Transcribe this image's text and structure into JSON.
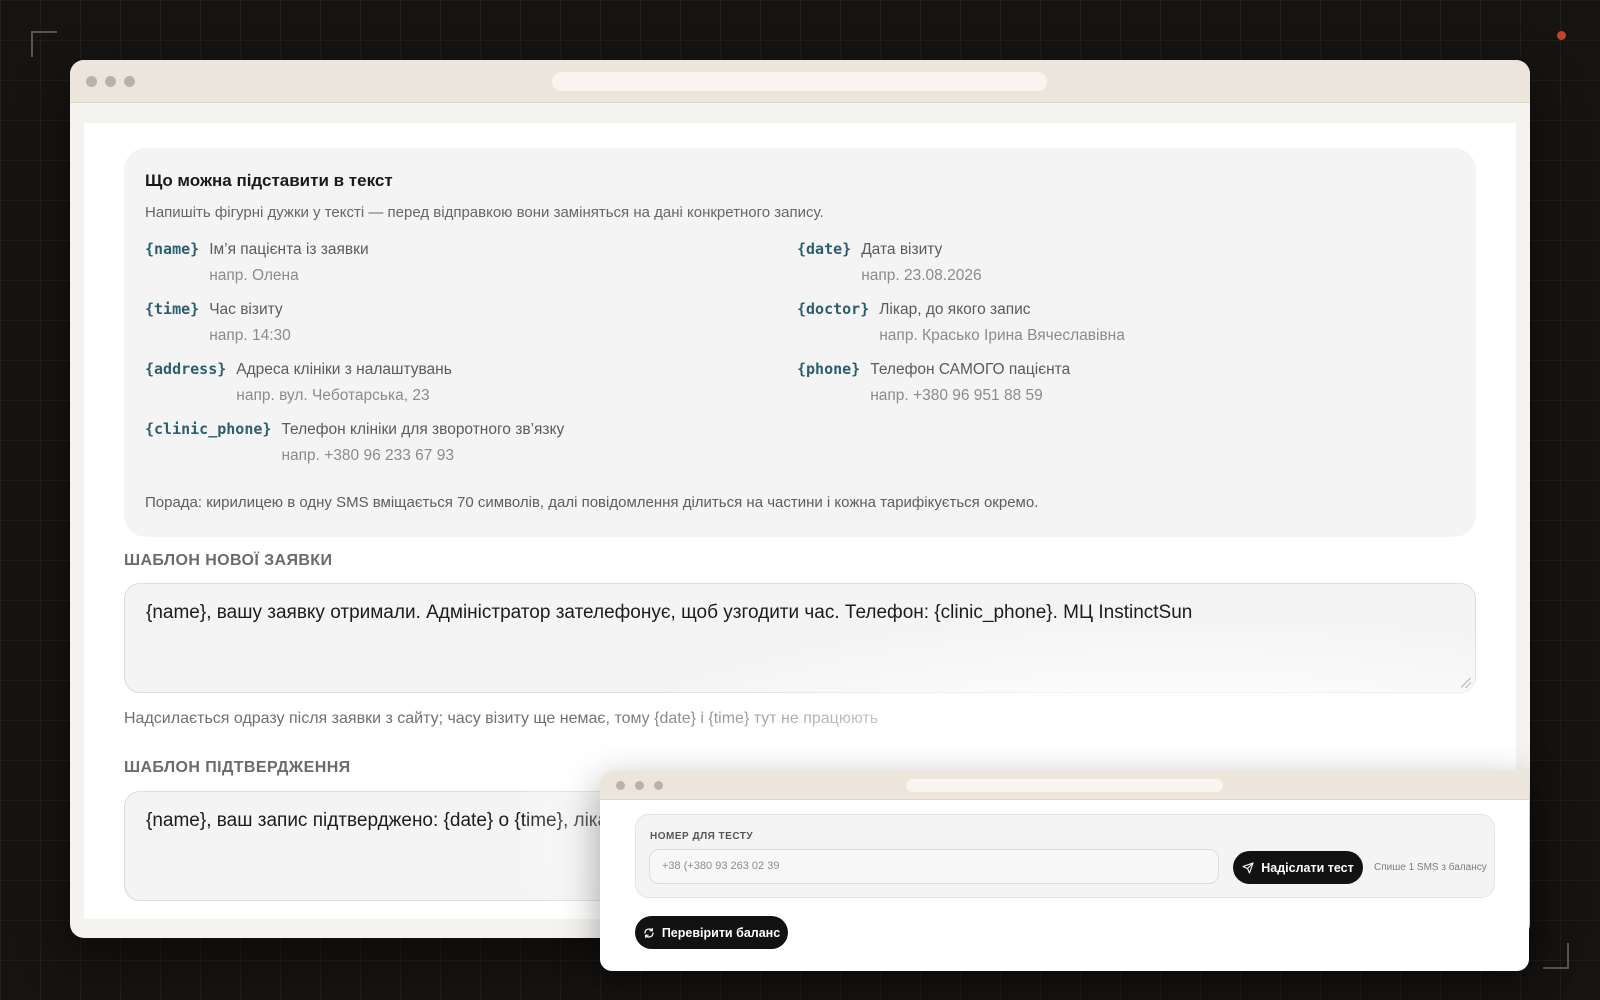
{
  "main": {
    "info_card": {
      "title": "Що можна підставити в текст",
      "description": "Напишіть фігурні дужки у тексті — перед відправкою вони заміняться на дані конкретного запису.",
      "variables": [
        {
          "code": "{name}",
          "desc": "Ім’я пацієнта із заявки",
          "example": "напр. Олена"
        },
        {
          "code": "{date}",
          "desc": "Дата візиту",
          "example": "напр. 23.08.2026"
        },
        {
          "code": "{time}",
          "desc": "Час візиту",
          "example": "напр. 14:30"
        },
        {
          "code": "{doctor}",
          "desc": "Лікар, до якого запис",
          "example": "напр. Красько Ірина Вячеславівна"
        },
        {
          "code": "{address}",
          "desc": "Адреса клініки з налаштувань",
          "example": "напр. вул. Чеботарська, 23"
        },
        {
          "code": "{phone}",
          "desc": "Телефон САМОГО пацієнта",
          "example": "напр. +380 96 951 88 59"
        },
        {
          "code": "{clinic_phone}",
          "desc": "Телефон клініки для зворотного зв’язку",
          "example": "напр. +380 96 233 67 93"
        }
      ],
      "tip": "Порада: кирилицею в одну SMS вміщається 70 символів, далі повідомлення ділиться на частини і кожна тарифікується окремо."
    },
    "new_request": {
      "label": "ШАБЛОН НОВОЇ ЗАЯВКИ",
      "value": "{name}, вашу заявку отримали. Адміністратор зателефонує, щоб узгодити час. Телефон: {clinic_phone}. МЦ InstinctSun",
      "hint": "Надсилається одразу після заявки з сайту; часу візиту ще немає, тому {date} і {time} тут не працюють"
    },
    "confirmation": {
      "label": "ШАБЛОН ПІДТВЕРДЖЕННЯ",
      "value": "{name}, ваш запис підтверджено: {date} о {time}, лікар"
    }
  },
  "test_window": {
    "label": "НОМЕР ДЛЯ ТЕСТУ",
    "input_value": "+38 (+380 93 263 02 39",
    "send_button": "Надіслати тест",
    "send_note": "Спише 1 SMS з балансу",
    "balance_button": "Перевірити баланс"
  },
  "colors": {
    "accent_code": "#2c5f6e",
    "button_dark": "#121212",
    "titlebar": "#ece5db"
  },
  "icons": {
    "send": "paper-plane-icon",
    "refresh": "refresh-icon"
  }
}
